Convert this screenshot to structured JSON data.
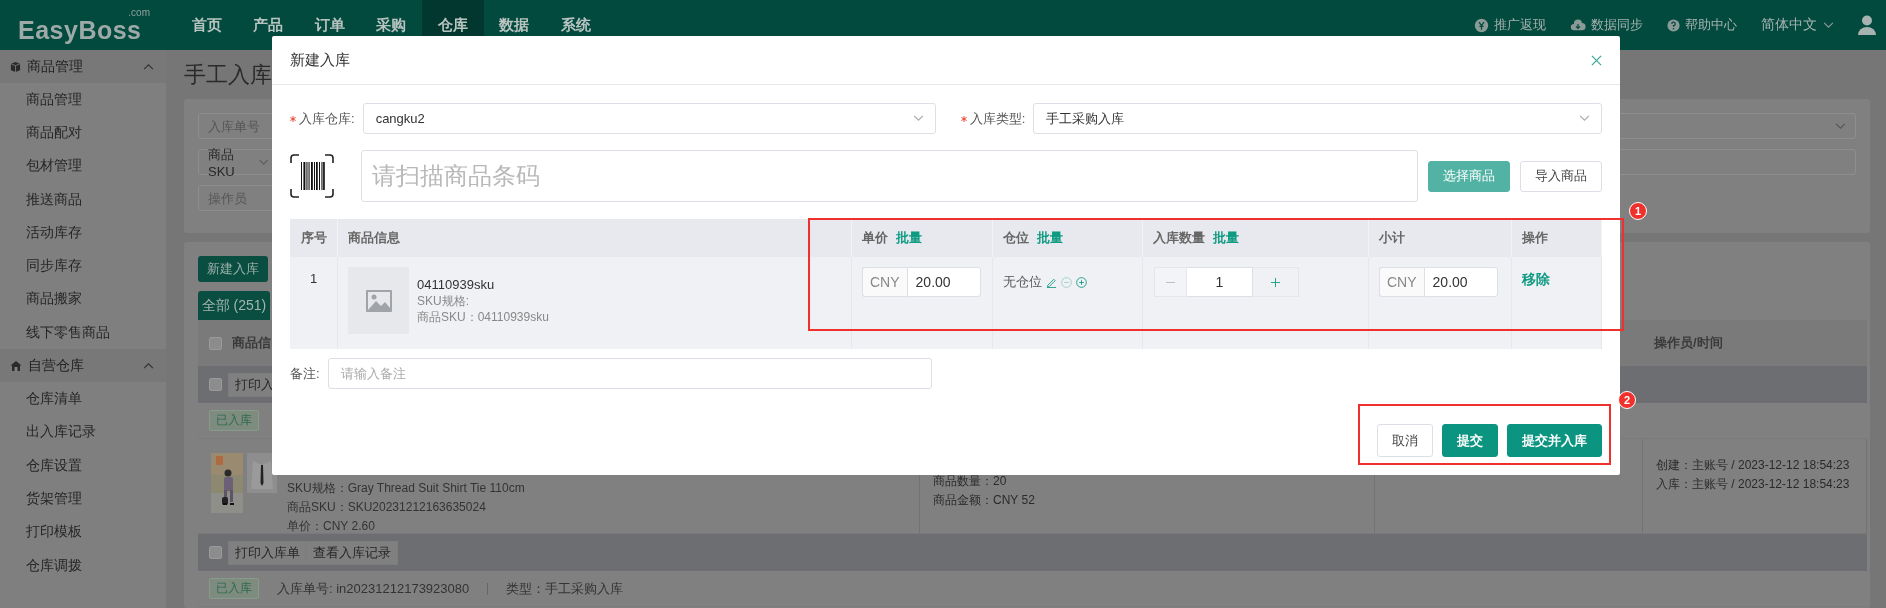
{
  "header": {
    "logo": "EasyBoss",
    "logo_suffix": ".com",
    "nav": [
      {
        "label": "首页",
        "selected": false
      },
      {
        "label": "产品",
        "selected": false
      },
      {
        "label": "订单",
        "selected": false
      },
      {
        "label": "采购",
        "selected": false
      },
      {
        "label": "仓库",
        "selected": true
      },
      {
        "label": "数据",
        "selected": false
      },
      {
        "label": "系统",
        "selected": false
      }
    ],
    "links": [
      "推广返现",
      "数据同步",
      "帮助中心"
    ],
    "language": "简体中文"
  },
  "sidebar": [
    {
      "label": "商品管理",
      "expanded": true,
      "children": [
        {
          "label": "商品管理"
        },
        {
          "label": "商品配对"
        },
        {
          "label": "包材管理"
        },
        {
          "label": "推送商品"
        },
        {
          "label": "活动库存"
        },
        {
          "label": "同步库存"
        },
        {
          "label": "商品搬家"
        },
        {
          "label": "线下零售商品"
        }
      ]
    },
    {
      "label": "自营仓库",
      "expanded": true,
      "children": [
        {
          "label": "仓库清单"
        },
        {
          "label": "出入库记录"
        },
        {
          "label": "仓库设置"
        },
        {
          "label": "货架管理"
        },
        {
          "label": "打印模板"
        },
        {
          "label": "仓库调拨"
        }
      ]
    }
  ],
  "page": {
    "title": "手工入库",
    "filters": [
      {
        "kind": "input",
        "placeholder": "入库单号"
      },
      {
        "kind": "select",
        "value": "商品SKU"
      },
      {
        "kind": "input",
        "placeholder": "操作员"
      }
    ],
    "actions": [
      "新建入库"
    ],
    "tabs": [
      {
        "label": "全部 (251)",
        "selected": true
      }
    ],
    "table": {
      "checked": false,
      "columns": [
        "商品信",
        "操作员/时间"
      ],
      "groups": [
        {
          "checked": false,
          "buttons": [
            "打印入"
          ],
          "status": "已入库",
          "item": {
            "kind": "picture",
            "lines": [
              "SKU规格：Gray Thread Suit Shirt Tie 110cm",
              "商品SKU：SKU20231212163635024",
              "单价：CNY 2.60"
            ],
            "summary": [
              "商品数量：20",
              "商品金额：CNY 52"
            ],
            "operator": [
              "创建：主账号 / 2023-12-12 18:54:23",
              "入库：主账号 / 2023-12-12 18:54:23"
            ]
          }
        },
        {
          "checked": false,
          "buttons": [
            "打印入库单",
            "查看入库记录"
          ],
          "status": "已入库",
          "info": [
            "入库单号: in20231212173923080",
            "类型：手工采购入库"
          ]
        }
      ]
    }
  },
  "dialog": {
    "title": "新建入库",
    "fields": [
      {
        "label": "入库仓库:",
        "required": true,
        "value": "cangku2"
      },
      {
        "label": "入库类型:",
        "required": true,
        "value": "手工采购入库"
      }
    ],
    "scan": {
      "placeholder": "请扫描商品条码"
    },
    "scan_buttons": [
      {
        "label": "选择商品",
        "kind": "primary-light"
      },
      {
        "label": "导入商品",
        "kind": "default"
      }
    ],
    "table": {
      "columns": [
        {
          "label": "序号"
        },
        {
          "label": "商品信息"
        },
        {
          "label": "单价",
          "action": "批量"
        },
        {
          "label": "仓位",
          "action": "批量"
        },
        {
          "label": "入库数量",
          "action": "批量"
        },
        {
          "label": "小计"
        },
        {
          "label": "操作"
        }
      ],
      "rows": [
        {
          "index": "1",
          "name": "04110939sku",
          "spec": "SKU规格:",
          "sku": "商品SKU：04110939sku",
          "price_currency": "CNY",
          "price": "20.00",
          "location": "无仓位",
          "quantity": "1",
          "subtotal_currency": "CNY",
          "subtotal": "20.00",
          "action": "移除"
        }
      ]
    },
    "remark": {
      "label": "备注:",
      "placeholder": "请输入备注"
    },
    "buttons": [
      {
        "label": "取消",
        "kind": "default"
      },
      {
        "label": "提交",
        "kind": "primary"
      },
      {
        "label": "提交并入库",
        "kind": "primary"
      }
    ]
  },
  "annotations": [
    {
      "label": "1"
    },
    {
      "label": "2"
    }
  ]
}
